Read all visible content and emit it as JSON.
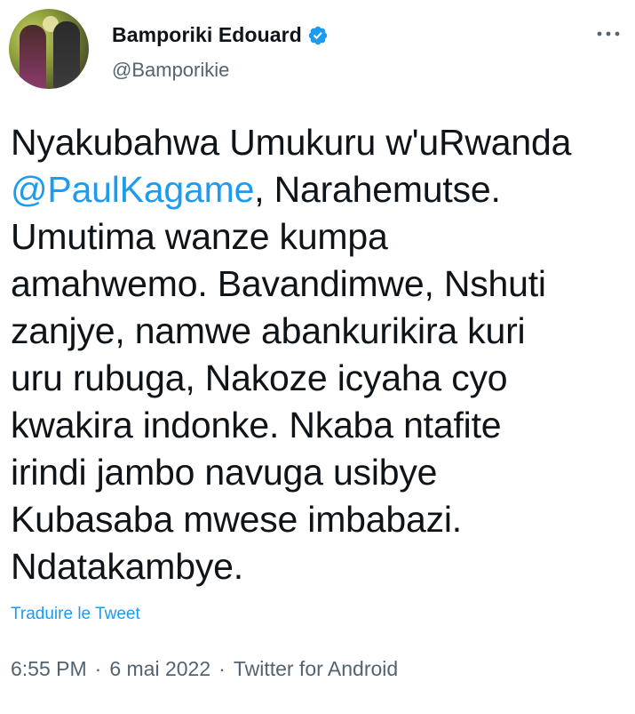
{
  "author": {
    "display_name": "Bamporiki Edouard",
    "handle": "@Bamporikie",
    "verified": true,
    "avatar_icon": "profile-photo"
  },
  "tweet": {
    "lines": [
      {
        "text": "Nyakubahwa Umukuru w'uRwanda"
      },
      {
        "mention": "@PaulKagame",
        "text": ", Narahemutse."
      },
      {
        "text": "Umutima wanze kumpa"
      },
      {
        "text": "amahwemo. Bavandimwe, Nshuti"
      },
      {
        "text": "zanjye, namwe abankurikira kuri"
      },
      {
        "text": "uru rubuga, Nakoze icyaha cyo"
      },
      {
        "text": "kwakira indonke. Nkaba ntafite"
      },
      {
        "text": "irindi jambo navuga usibye"
      },
      {
        "text": "Kubasaba mwese imbabazi."
      },
      {
        "text": "Ndatakambye."
      }
    ],
    "translate_label": "Traduire le Tweet"
  },
  "meta": {
    "time": "6:55 PM",
    "separator": "·",
    "date": "6 mai 2022",
    "source": "Twitter for Android"
  },
  "colors": {
    "accent": "#1d9bf0",
    "text": "#0f1419",
    "secondary": "#536471"
  }
}
